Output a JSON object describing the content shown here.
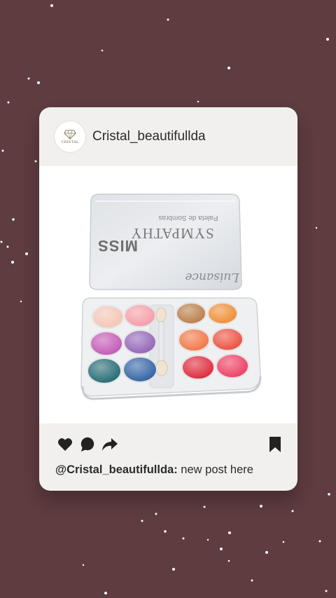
{
  "post": {
    "username": "Cristal_beautifullda",
    "avatar_text": "CRISTAL",
    "caption_handle": "@Cristal_beautifullda:",
    "caption_text": " new post here"
  },
  "product": {
    "brand": "Luisance",
    "title_line1": "MISS",
    "title_line2": "SYMPATHY",
    "subtitle": "Paleta de Sombras"
  },
  "actions": {
    "like_icon": "heart-icon",
    "comment_icon": "comment-icon",
    "share_icon": "share-icon",
    "save_icon": "bookmark-icon"
  },
  "colors": {
    "background": "#5e3c40",
    "card": "#f1f0ef",
    "eyeshadows_left": [
      "#f2c4b2",
      "#f49aa6",
      "#c154b4",
      "#9060b6",
      "#1f6670",
      "#2d5fa0"
    ],
    "eyeshadows_right": [
      "#b87a45",
      "#ef8a30",
      "#f17240",
      "#ec4b3c",
      "#dd2436",
      "#ec3a5e"
    ]
  }
}
